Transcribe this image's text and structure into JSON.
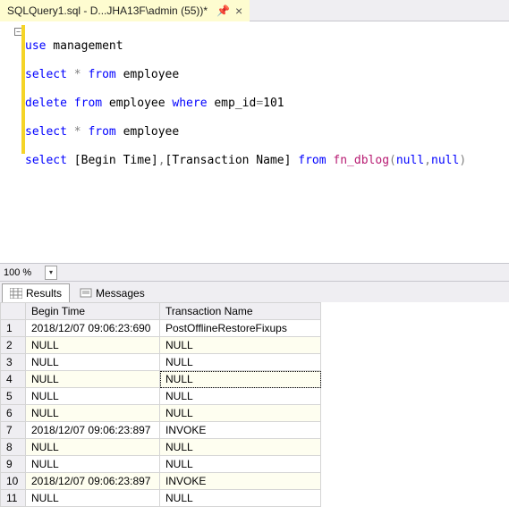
{
  "tab": {
    "title": "SQLQuery1.sql - D...JHA13F\\admin (55))*"
  },
  "zoom": {
    "value": "100 %"
  },
  "code": {
    "l1a": "use",
    "l1b": " management",
    "l2a": "select",
    "l2b": " * ",
    "l2c": "from",
    "l2d": " employee",
    "l3a": "delete",
    "l3b": " ",
    "l3c": "from",
    "l3d": " employee ",
    "l3e": "where",
    "l3f": " emp_id",
    "l3g": "=",
    "l3h": "101",
    "l4a": "select",
    "l4b": " * ",
    "l4c": "from",
    "l4d": " employee",
    "l5a": "select",
    "l5b": " [Begin Time]",
    "l5c": ",",
    "l5d": "[Transaction Name] ",
    "l5e": "from",
    "l5f": " ",
    "l5g": "fn_dblog",
    "l5h": "(",
    "l5i": "null",
    "l5j": ",",
    "l5k": "null",
    "l5l": ")"
  },
  "resultsTabs": {
    "results": "Results",
    "messages": "Messages"
  },
  "grid": {
    "headers": {
      "c0": "",
      "c1": "Begin Time",
      "c2": "Transaction Name"
    },
    "rows": [
      {
        "n": "1",
        "begin": "2018/12/07 09:06:23:690",
        "tname": "PostOfflineRestoreFixups"
      },
      {
        "n": "2",
        "begin": "NULL",
        "tname": "NULL"
      },
      {
        "n": "3",
        "begin": "NULL",
        "tname": "NULL"
      },
      {
        "n": "4",
        "begin": "NULL",
        "tname": "NULL"
      },
      {
        "n": "5",
        "begin": "NULL",
        "tname": "NULL"
      },
      {
        "n": "6",
        "begin": "NULL",
        "tname": "NULL"
      },
      {
        "n": "7",
        "begin": "2018/12/07 09:06:23:897",
        "tname": "INVOKE"
      },
      {
        "n": "8",
        "begin": "NULL",
        "tname": "NULL"
      },
      {
        "n": "9",
        "begin": "NULL",
        "tname": "NULL"
      },
      {
        "n": "10",
        "begin": "2018/12/07 09:06:23:897",
        "tname": "INVOKE"
      },
      {
        "n": "11",
        "begin": "NULL",
        "tname": "NULL"
      }
    ]
  }
}
